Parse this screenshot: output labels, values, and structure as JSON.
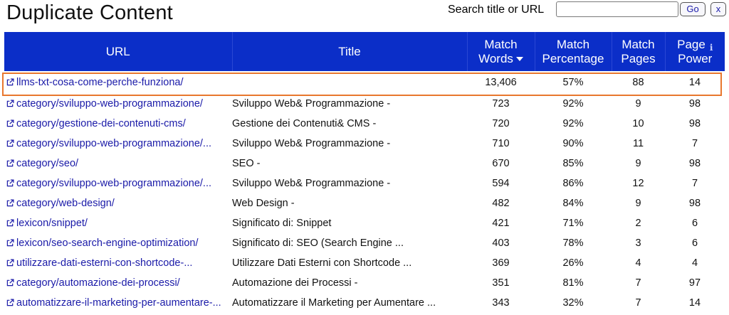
{
  "page": {
    "title": "Duplicate Content"
  },
  "search": {
    "label": "Search title or URL",
    "value": "",
    "placeholder": "",
    "go_label": "Go",
    "clear_label": "x"
  },
  "table": {
    "headers": {
      "url": "URL",
      "title": "Title",
      "match_words_line1": "Match",
      "match_words_line2": "Words",
      "match_pct_line1": "Match",
      "match_pct_line2": "Percentage",
      "match_pages_line1": "Match",
      "match_pages_line2": "Pages",
      "page_power_line1": "Page",
      "page_power_line2": "Power"
    },
    "sort": {
      "column": "match_words",
      "direction": "descending"
    },
    "colors": {
      "header_bg": "#0b2ec8",
      "link": "#1a1aa8",
      "highlight": "#e8772e"
    },
    "rows": [
      {
        "url": "llms-txt-cosa-come-perche-funziona/",
        "title": "",
        "match_words": "13,406",
        "match_pct": "57%",
        "match_pages": "88",
        "page_power": "14",
        "highlighted": true
      },
      {
        "url": "category/sviluppo-web-programmazione/",
        "title": "Sviluppo Web& Programmazione -",
        "match_words": "723",
        "match_pct": "92%",
        "match_pages": "9",
        "page_power": "98"
      },
      {
        "url": "category/gestione-dei-contenuti-cms/",
        "title": "Gestione dei Contenuti& CMS -",
        "match_words": "720",
        "match_pct": "92%",
        "match_pages": "10",
        "page_power": "98"
      },
      {
        "url": "category/sviluppo-web-programmazione/...",
        "title": "Sviluppo Web& Programmazione -",
        "match_words": "710",
        "match_pct": "90%",
        "match_pages": "11",
        "page_power": "7"
      },
      {
        "url": "category/seo/",
        "title": "SEO -",
        "match_words": "670",
        "match_pct": "85%",
        "match_pages": "9",
        "page_power": "98"
      },
      {
        "url": "category/sviluppo-web-programmazione/...",
        "title": "Sviluppo Web& Programmazione -",
        "match_words": "594",
        "match_pct": "86%",
        "match_pages": "12",
        "page_power": "7"
      },
      {
        "url": "category/web-design/",
        "title": "Web Design -",
        "match_words": "482",
        "match_pct": "84%",
        "match_pages": "9",
        "page_power": "98"
      },
      {
        "url": "lexicon/snippet/",
        "title": "Significato di: Snippet",
        "match_words": "421",
        "match_pct": "71%",
        "match_pages": "2",
        "page_power": "6"
      },
      {
        "url": "lexicon/seo-search-engine-optimization/",
        "title": "Significato di: SEO (Search Engine ...",
        "match_words": "403",
        "match_pct": "78%",
        "match_pages": "3",
        "page_power": "6"
      },
      {
        "url": "utilizzare-dati-esterni-con-shortcode-...",
        "title": "Utilizzare Dati Esterni con Shortcode ...",
        "match_words": "369",
        "match_pct": "26%",
        "match_pages": "4",
        "page_power": "4"
      },
      {
        "url": "category/automazione-dei-processi/",
        "title": "Automazione dei Processi -",
        "match_words": "351",
        "match_pct": "81%",
        "match_pages": "7",
        "page_power": "97"
      },
      {
        "url": "automatizzare-il-marketing-per-aumentare-...",
        "title": "Automatizzare il Marketing per Aumentare ...",
        "match_words": "343",
        "match_pct": "32%",
        "match_pages": "7",
        "page_power": "14"
      }
    ]
  },
  "icons": {
    "row_link": "external-link-icon",
    "sort": "sort-down-icon",
    "info": "info-icon"
  }
}
